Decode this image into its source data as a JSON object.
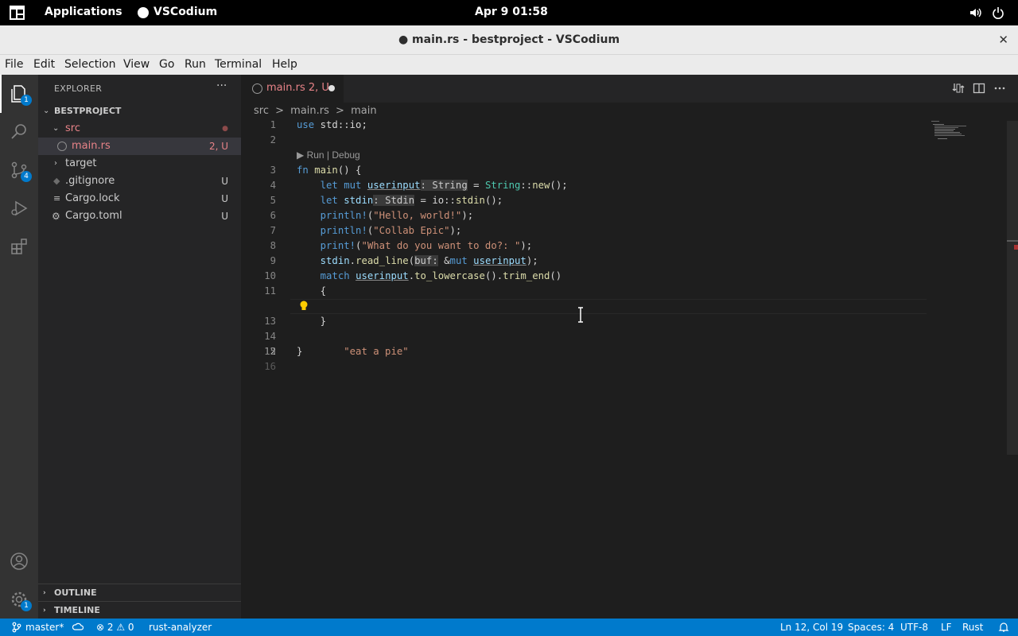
{
  "topbar": {
    "applications": "Applications",
    "app_name": "VSCodium",
    "clock": "Apr 9  01:58"
  },
  "window": {
    "title": "● main.rs - bestproject - VSCodium",
    "close": "✕"
  },
  "menu": [
    "File",
    "Edit",
    "Selection",
    "View",
    "Go",
    "Run",
    "Terminal",
    "Help"
  ],
  "activitybar": {
    "explorer_badge": "1",
    "scm_badge": "4",
    "settings_badge": "1"
  },
  "sidebar": {
    "title": "EXPLORER",
    "more": "···",
    "project": "BESTPROJECT",
    "tree": [
      {
        "label": "src",
        "status": "●"
      },
      {
        "label": "main.rs",
        "status": "2, U"
      },
      {
        "label": "target",
        "status": ""
      },
      {
        "label": ".gitignore",
        "status": "U"
      },
      {
        "label": "Cargo.lock",
        "status": "U"
      },
      {
        "label": "Cargo.toml",
        "status": "U"
      }
    ],
    "outline": "OUTLINE",
    "timeline": "TIMELINE"
  },
  "editor": {
    "tab_label": "main.rs  2, U",
    "breadcrumb": [
      "src",
      ">",
      "main.rs",
      ">",
      "main"
    ],
    "codelens": "▶ Run | Debug",
    "line_numbers": [
      "1",
      "2",
      "3",
      "4",
      "5",
      "6",
      "7",
      "8",
      "9",
      "10",
      "11",
      "12",
      "13",
      "14",
      "15",
      "16"
    ]
  },
  "statusbar": {
    "branch": "master*",
    "problems": "⊗ 2 ⚠ 0",
    "analyzer": "rust-analyzer",
    "position": "Ln 12, Col 19",
    "spaces": "Spaces: 4",
    "encoding": "UTF-8",
    "eol": "LF",
    "language": "Rust"
  },
  "colors": {
    "activitybar": "#333333",
    "sidebar": "#252526",
    "editor": "#1e1e1e",
    "statusbar": "#007acc"
  }
}
